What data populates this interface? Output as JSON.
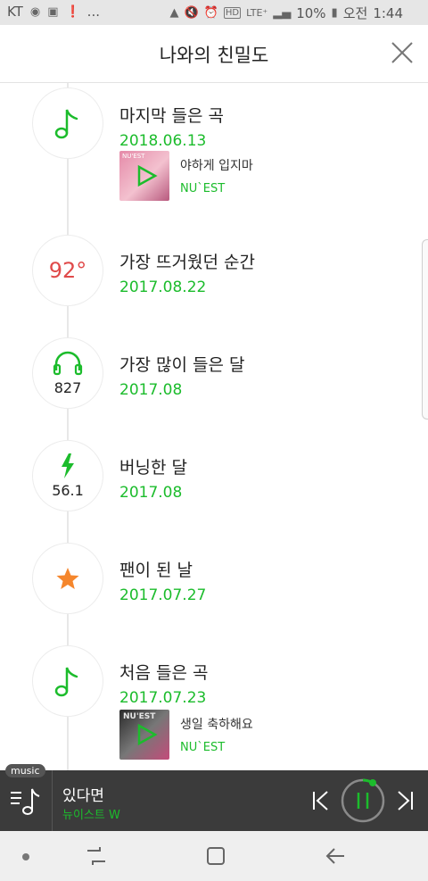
{
  "status_bar": {
    "carrier": "KT",
    "dots": "...",
    "lte": "LTE⁺",
    "battery_percent": "10%",
    "ampm": "오전",
    "time": "1:44"
  },
  "header": {
    "title": "나와의 친밀도"
  },
  "timeline": [
    {
      "icon": "music-note-icon",
      "label": "마지막 들은 곡",
      "date": "2018.06.13",
      "song": {
        "title": "야하게 입지마",
        "artist": "NU`EST",
        "album_text": "NU'EST"
      }
    },
    {
      "icon": "temperature-icon",
      "value": "92°",
      "label": "가장 뜨거웠던 순간",
      "date": "2017.08.22"
    },
    {
      "icon": "headphones-icon",
      "value": "827",
      "label": "가장 많이 들은 달",
      "date": "2017.08"
    },
    {
      "icon": "lightning-icon",
      "value": "56.1",
      "label": "버닝한 달",
      "date": "2017.08"
    },
    {
      "icon": "star-icon",
      "label": "팬이 된 날",
      "date": "2017.07.27"
    },
    {
      "icon": "music-note-icon",
      "label": "처음 들은 곡",
      "date": "2017.07.23",
      "song": {
        "title": "생일 축하해요",
        "artist": "NU`EST",
        "album_text": "NU'EST"
      }
    }
  ],
  "player": {
    "badge": "music",
    "song": "있다면",
    "artist": "뉴이스트 W"
  },
  "colors": {
    "accent_green": "#1cbc2c",
    "temp_red": "#e04a4a",
    "star_orange": "#f5862c",
    "player_bg": "#3b3b3b"
  }
}
